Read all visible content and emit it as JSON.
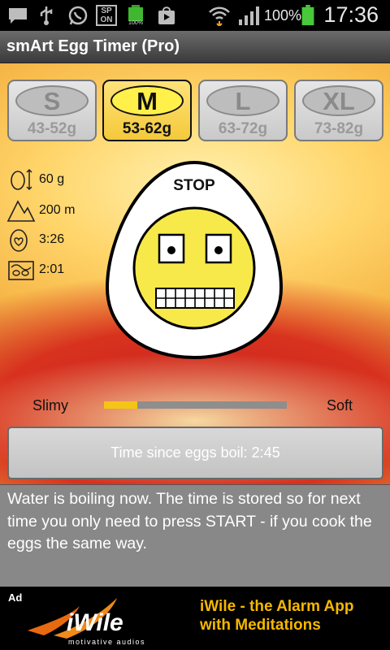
{
  "status_bar": {
    "battery_percent": "100%",
    "time": "17:36",
    "sp_on_badge": [
      "SP",
      "ON"
    ],
    "battery_badge": "100%",
    "icons": [
      "message-icon",
      "usb-icon",
      "whatsapp-icon",
      "sp-on-icon",
      "battery-full-icon",
      "play-store-icon",
      "wifi-icon",
      "signal-icon",
      "battery-icon"
    ]
  },
  "app": {
    "title": "smArt Egg Timer  (Pro)"
  },
  "sizes": [
    {
      "letter": "S",
      "range": "43-52g",
      "selected": false
    },
    {
      "letter": "M",
      "range": "53-62g",
      "selected": true
    },
    {
      "letter": "L",
      "range": "63-72g",
      "selected": false
    },
    {
      "letter": "XL",
      "range": "73-82g",
      "selected": false
    }
  ],
  "info": {
    "weight": "60 g",
    "altitude": "200 m",
    "cook_time": "3:26",
    "elapsed": "2:01"
  },
  "egg": {
    "label": "STOP"
  },
  "doneness": {
    "left_label": "Slimy",
    "right_label": "Soft",
    "level": 0.18
  },
  "timer": {
    "text": "Time since eggs boil: 2:45"
  },
  "message": {
    "text": "Water is boiling now. The time is stored  so for next time you only need to press START - if you cook the eggs the same way."
  },
  "ad": {
    "tag": "Ad",
    "brand": "iWile",
    "slogan": "motivative audios",
    "headline_1": "iWile - the Alarm App",
    "headline_2": "with Meditations"
  },
  "colors": {
    "selected_button": "#f4c93a",
    "egg_face": "#f7e94a",
    "slider_fill": "#f4c515",
    "ad_text": "#f5b800"
  }
}
